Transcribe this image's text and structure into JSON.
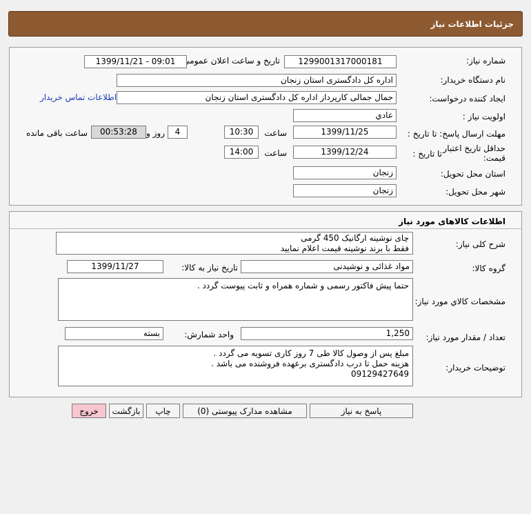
{
  "header": {
    "title": "جزئیات اطلاعات نیاز"
  },
  "labels": {
    "need_number": "شماره نیاز:",
    "announce_datetime": "تاریخ و ساعت اعلان عمومی:",
    "buyer_org": "نام دستگاه خریدار:",
    "requester": "ایجاد کننده درخواست:",
    "contact_link": "اطلاعات تماس خریدار",
    "priority": "اولویت نیاز :",
    "deadline_send": "مهلت ارسال پاسخ: تا تاریخ :",
    "hour": "ساعت",
    "day_and": "روز و",
    "remaining": "ساعت باقی مانده",
    "price_validity": "حداقل تاریخ اعتبار قیمت:",
    "until_date": "تا تاریخ :",
    "hour2": "ساعت",
    "province": "استان محل تحویل:",
    "city": "شهر محل تحویل:"
  },
  "values": {
    "need_number": "1299001317000181",
    "announce_datetime": "1399/11/21 - 09:01",
    "buyer_org": "اداره کل دادگستری استان زنجان",
    "requester": "جمال جمالی کارپرداز اداره کل دادگستری استان زنجان",
    "priority": "عادي",
    "deadline_date": "1399/11/25",
    "deadline_time": "10:30",
    "days_left": "4",
    "time_left": "00:53:28",
    "validity_date": "1399/12/24",
    "validity_time": "14:00",
    "province": "زنجان",
    "city": "زنجان"
  },
  "goods": {
    "section_title": "اطلاعات کالاهای مورد نیاز",
    "labels": {
      "description": "شرح کلی نیاز:",
      "group": "گروه کالا:",
      "need_date": "تاریخ نیاز به کالا:",
      "specs": "مشخصات کالاي مورد نیاز:",
      "quantity": "تعداد / مقدار مورد نیاز:",
      "unit": "واحد شمارش:",
      "buyer_notes": "توضیحات خریدار:"
    },
    "description": "چای نوشینه ارگانیک 450 گرمی\nفقط با برند نوشینه قیمت اعلام نمایید",
    "group": "مواد غذائی و نوشیدنی",
    "need_date": "1399/11/27",
    "specs": "حتما پیش فاکتور رسمی و شماره همراه و ثابت پیوست گردد .",
    "quantity": "1,250",
    "unit": "بسته",
    "buyer_notes": "مبلغ پس از وصول کالا طی 7 روز کاری تسویه می گردد .\nهزینه حمل تا درب دادگستری برعهده فروشنده می باشد .\n09129427649"
  },
  "buttons": {
    "reply": "پاسخ به نیاز",
    "attachments": "مشاهده مدارک پیوستی (0)",
    "print": "چاپ",
    "back": "بازگشت",
    "exit": "خروج"
  }
}
